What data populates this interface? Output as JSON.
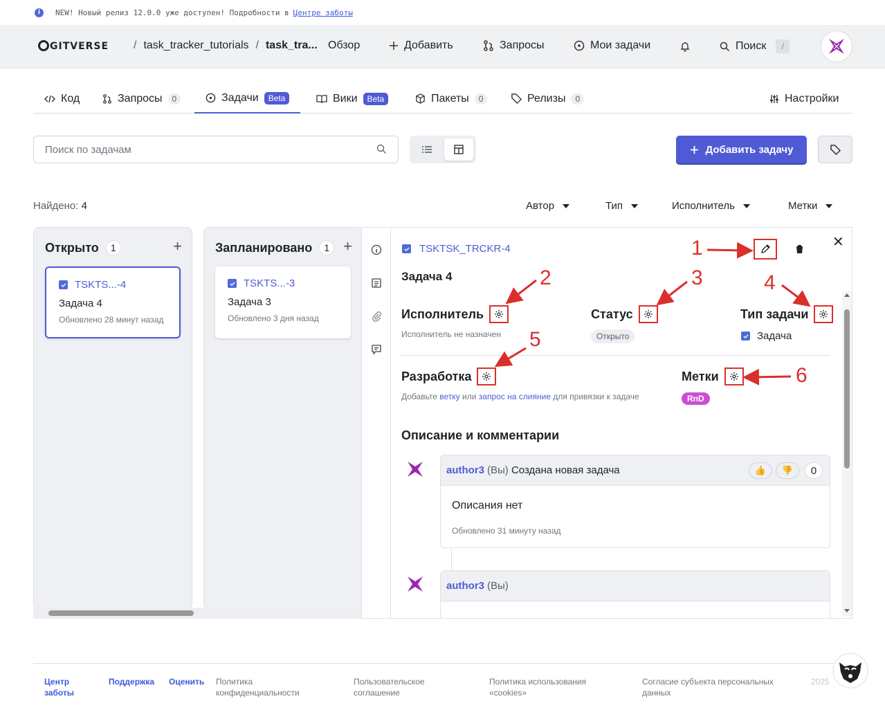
{
  "banner": {
    "text": "NEW! Новый релиз 12.0.0 уже доступен! Подробности в",
    "link": "Центре заботы"
  },
  "topbar": {
    "logo": "GITVERSE",
    "crumb_repo_owner": "task_tracker_tutorials",
    "crumb_repo": "task_tra...",
    "nav_overview": "Обзор",
    "nav_add": "Добавить",
    "nav_requests": "Запросы",
    "nav_my_tasks": "Мои задачи",
    "nav_search": "Поиск",
    "search_key": "/"
  },
  "tabs": {
    "code": "Код",
    "requests": "Запросы",
    "requests_count": "0",
    "tasks": "Задачи",
    "tasks_badge": "Beta",
    "wiki": "Вики",
    "wiki_badge": "Beta",
    "packages": "Пакеты",
    "packages_count": "0",
    "releases": "Релизы",
    "releases_count": "0",
    "settings": "Настройки"
  },
  "toolbar": {
    "search_placeholder": "Поиск по задачам",
    "add_task": "Добавить задачу"
  },
  "filters": {
    "found_label": "Найдено:",
    "found_count": "4",
    "author": "Автор",
    "type": "Тип",
    "assignee": "Исполнитель",
    "labels": "Метки"
  },
  "columns": [
    {
      "title": "Открыто",
      "count": "1",
      "card": {
        "id": "TSKTS...-4",
        "title": "Задача 4",
        "updated": "Обновлено 28 минут назад"
      }
    },
    {
      "title": "Запланировано",
      "count": "1",
      "card": {
        "id": "TSKTS...-3",
        "title": "Задача 3",
        "updated": "Обновлено 3 дня назад"
      }
    }
  ],
  "detail": {
    "id": "TSKTSK_TRCKR-4",
    "title": "Задача 4",
    "assignee_label": "Исполнитель",
    "assignee_value": "Исполнитель не назначен",
    "status_label": "Статус",
    "status_value": "Открыто",
    "type_label": "Тип задачи",
    "type_value": "Задача",
    "dev_label": "Разработка",
    "dev_text_1": "Добавьте",
    "dev_link_branch": "ветку",
    "dev_text_2": "или",
    "dev_link_pr": "запрос на слияние",
    "dev_text_3": "для привязки к задаче",
    "labels_label": "Метки",
    "label_tag": "RnD",
    "comments_heading": "Описание и комментарии",
    "comment1": {
      "author": "author3",
      "you": "(Вы)",
      "action": "Создана новая задача",
      "reaction_count": "0",
      "body": "Описания нет",
      "updated": "Обновлено 31 минуту назад"
    },
    "comment2": {
      "author": "author3",
      "you": "(Вы)"
    }
  },
  "annotations": [
    "1",
    "2",
    "3",
    "4",
    "5",
    "6"
  ],
  "footer": {
    "care": "Центр заботы",
    "support": "Поддержка",
    "rate": "Оценить",
    "privacy": "Политика конфиденциальности",
    "agreement": "Пользовательское соглашение",
    "cookies": "Политика использования «cookies»",
    "consent": "Согласие субъекта персональных данных",
    "year": "2025"
  },
  "colors": {
    "accent": "#4f5bd5",
    "annotation": "#d9302c",
    "label_rnd": "#c94fd6"
  }
}
